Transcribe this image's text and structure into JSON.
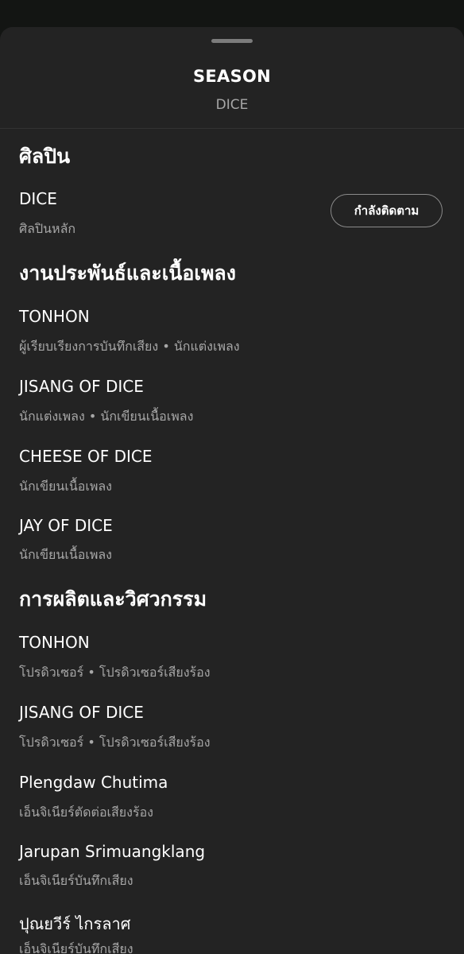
{
  "header": {
    "title": "SEASON",
    "subtitle": "DICE"
  },
  "sections": {
    "artist": {
      "title": "ศิลปิน",
      "items": [
        {
          "name": "DICE",
          "role": "ศิลปินหลัก",
          "button": "กำลังติดตาม"
        }
      ]
    },
    "composition": {
      "title": "งานประพันธ์และเนื้อเพลง",
      "items": [
        {
          "name": "TONHON",
          "role": "ผู้เรียบเรียงการบันทึกเสียง • นักแต่งเพลง"
        },
        {
          "name": "JISANG OF DICE",
          "role": "นักแต่งเพลง • นักเขียนเนื้อเพลง"
        },
        {
          "name": "CHEESE OF DICE",
          "role": "นักเขียนเนื้อเพลง"
        },
        {
          "name": "JAY OF DICE",
          "role": "นักเขียนเนื้อเพลง"
        }
      ]
    },
    "production": {
      "title": "การผลิตและวิศวกรรม",
      "items": [
        {
          "name": "TONHON",
          "role": "โปรดิวเซอร์ • โปรดิวเซอร์เสียงร้อง"
        },
        {
          "name": "JISANG OF DICE",
          "role": "โปรดิวเซอร์ • โปรดิวเซอร์เสียงร้อง"
        },
        {
          "name": "Plengdaw Chutima",
          "role": "เอ็นจิเนียร์ตัดต่อเสียงร้อง"
        },
        {
          "name": "Jarupan Srimuangklang",
          "role": "เอ็นจิเนียร์บันทึกเสียง"
        },
        {
          "name": "ปุณยวีร์ ไกรลาศ",
          "role": "เอ็นจิเนียร์บันทึกเสียง"
        }
      ]
    }
  },
  "colors": {
    "sheet_background": "#232323",
    "primary_text": "#ffffff",
    "secondary_text": "#a7a7a7"
  }
}
